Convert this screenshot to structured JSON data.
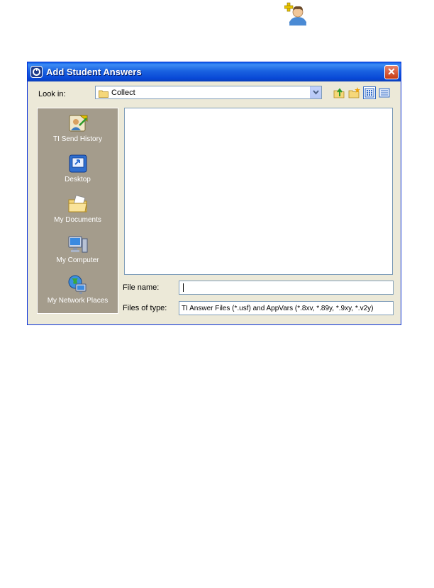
{
  "page": {
    "top_icon": "add-student-icon"
  },
  "dialog": {
    "title": "Add Student Answers",
    "title_icon": "ti-app-icon",
    "close_icon": "close-icon",
    "close_glyph": "✕",
    "look_in_label": "Look in:",
    "look_in_value": "Collect",
    "toolbar": [
      "up-folder-icon",
      "new-folder-icon",
      "list-view-icon",
      "details-view-icon"
    ],
    "places": [
      {
        "label": "TI Send History",
        "icon": "ti-send-history-icon"
      },
      {
        "label": "Desktop",
        "icon": "desktop-icon"
      },
      {
        "label": "My Documents",
        "icon": "my-documents-icon"
      },
      {
        "label": "My Computer",
        "icon": "my-computer-icon"
      },
      {
        "label": "My Network Places",
        "icon": "my-network-places-icon"
      }
    ],
    "file_name_label": "File name:",
    "file_name_value": "",
    "files_of_type_label": "Files of type:",
    "files_of_type_value": "TI Answer Files (*.usf) and AppVars (*.8xv, *.89y, *.9xy, *.v2y)"
  },
  "colors": {
    "titlebar": "#0a5ce6",
    "places_bar": "#a49c8c",
    "dialog_bg": "#ece9d8",
    "close_button": "#c63b13"
  }
}
